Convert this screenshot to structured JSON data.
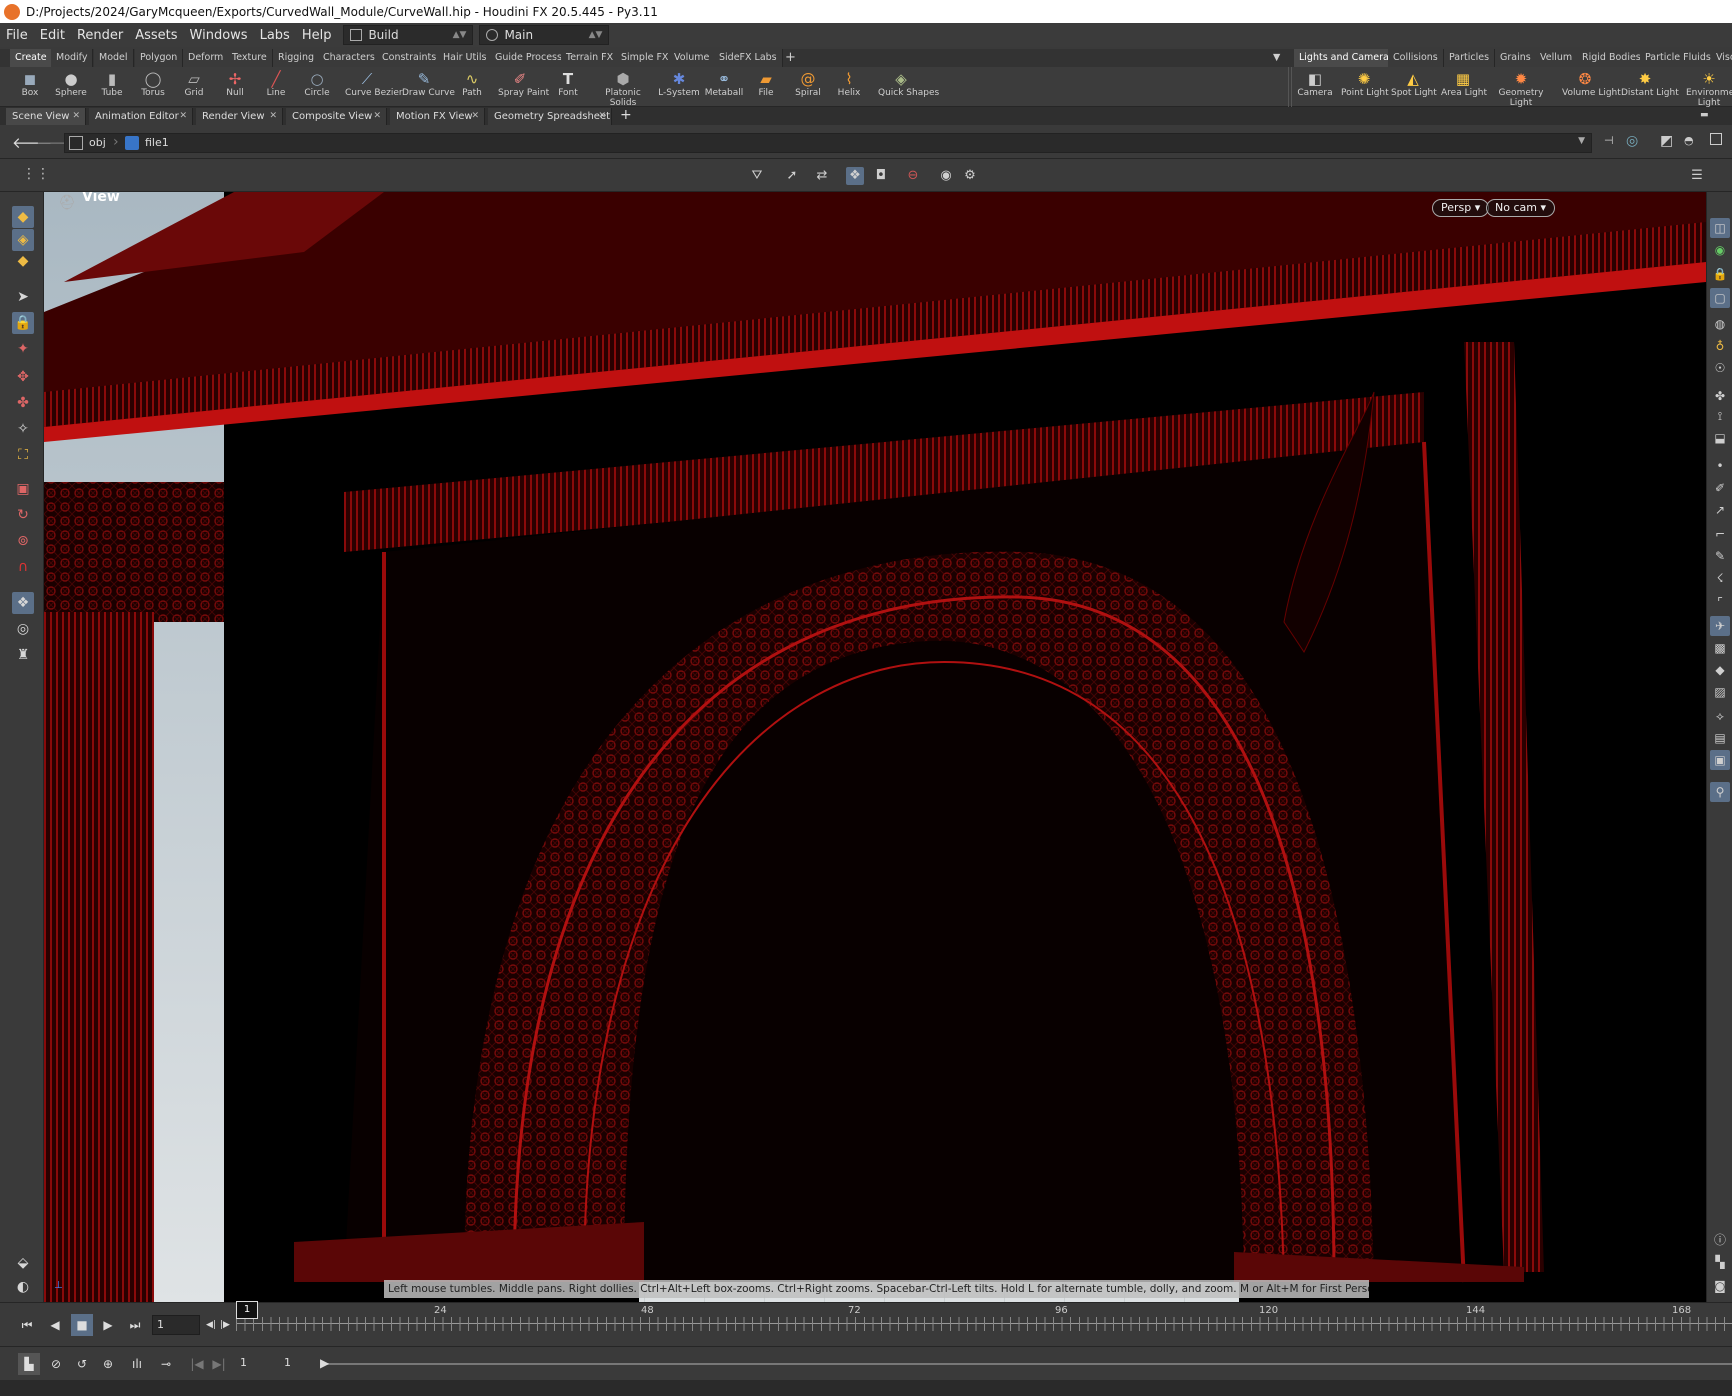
{
  "title": "D:/Projects/2024/GaryMcqueen/Exports/CurvedWall_Module/CurveWall.hip - Houdini FX 20.5.445 - Py3.11",
  "menu": [
    "File",
    "Edit",
    "Render",
    "Assets",
    "Windows",
    "Labs",
    "Help"
  ],
  "desktop": "Build",
  "context": "Main",
  "shelf_tabs_left": [
    "Create",
    "Modify",
    "Model",
    "Polygon",
    "Deform",
    "Texture",
    "Rigging",
    "Characters",
    "Constraints",
    "Hair Utils",
    "Guide Process",
    "Terrain FX",
    "Simple FX",
    "Volume",
    "SideFX Labs"
  ],
  "shelf_tabs_right": [
    "Lights and Cameras",
    "Collisions",
    "Particles",
    "Grains",
    "Vellum",
    "Rigid Bodies",
    "Particle Fluids",
    "Visc"
  ],
  "tools_left": [
    "Box",
    "Sphere",
    "Tube",
    "Torus",
    "Grid",
    "Null",
    "Line",
    "Circle",
    "Curve Bezier",
    "Draw Curve",
    "Path",
    "Spray Paint",
    "Font",
    "Platonic Solids",
    "L-System",
    "Metaball",
    "File",
    "Spiral",
    "Helix",
    "Quick Shapes"
  ],
  "tools_right": [
    "Camera",
    "Point Light",
    "Spot Light",
    "Area Light",
    "Geometry Light",
    "Volume Light",
    "Distant Light",
    "Environment Light"
  ],
  "pane_tabs": [
    "Scene View",
    "Animation Editor",
    "Render View",
    "Composite View",
    "Motion FX View",
    "Geometry Spreadsheet"
  ],
  "path": {
    "root": "obj",
    "node": "file1"
  },
  "viewport": {
    "label": "View",
    "persp": "Persp",
    "cam": "No cam",
    "hint": "Left mouse tumbles. Middle pans. Right dollies. Ctrl+Alt+Left box-zooms. Ctrl+Right zooms. Spacebar-Ctrl-Left tilts. Hold L for alternate tumble, dolly, and zoom. M or Alt+M for First Person Navigation."
  },
  "timeline": {
    "frame": "1",
    "ticks": [
      "24",
      "48",
      "72",
      "96",
      "120",
      "144",
      "168"
    ],
    "current_marker": "1",
    "range_start": "1",
    "range_end": "1"
  },
  "colors": {
    "accent": "#5b6f88",
    "geometry": "#b01010"
  }
}
